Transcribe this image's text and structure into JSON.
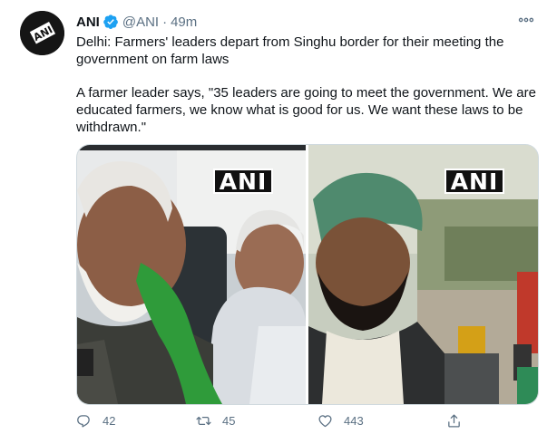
{
  "tweet": {
    "author_name": "ANI",
    "handle": "@ANI",
    "separator": "·",
    "time": "49m",
    "more_icon": "ellipsis-icon",
    "avatar_text": "ANI",
    "paragraphs": [
      "Delhi: Farmers' leaders depart from Singhu border for their meeting the government on farm laws",
      "A farmer leader says, \"35 leaders are going to meet the government. We are educated farmers, we know what is good for us. We want these laws to be withdrawn.\""
    ],
    "media": {
      "left_watermark": "ANI",
      "right_watermark": "ANI"
    },
    "actions": {
      "reply_count": "42",
      "retweet_count": "45",
      "like_count": "443",
      "share_label": ""
    }
  },
  "colors": {
    "verified": "#1da1f2",
    "secondary_text": "#5b7083",
    "primary_text": "#0f1419",
    "border": "#cfd9de"
  }
}
